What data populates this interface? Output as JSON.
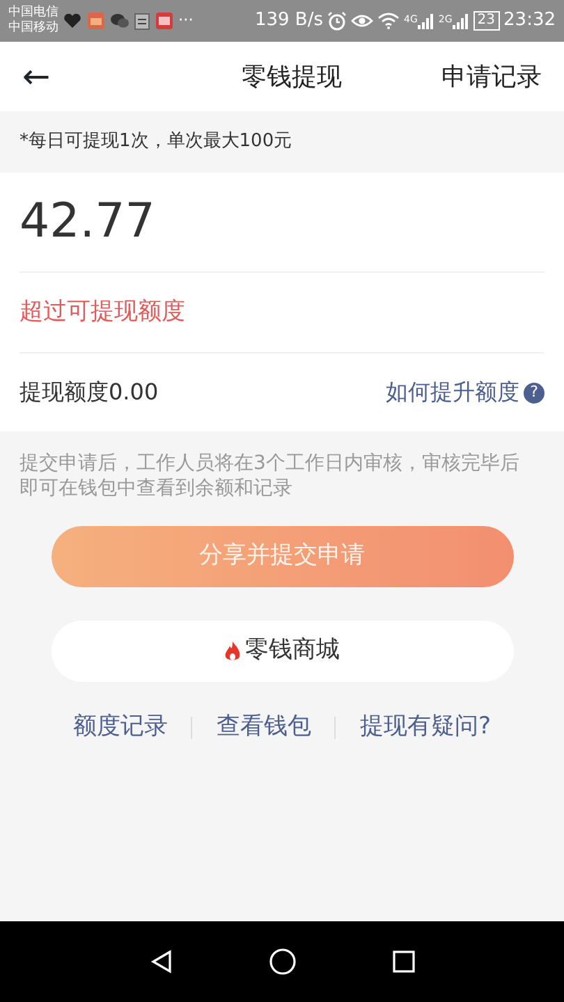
{
  "status_bar": {
    "carriers": [
      "中国电信",
      "中国移动"
    ],
    "more": "···",
    "speed": "139 B/s",
    "networks": [
      "4G",
      "2G"
    ],
    "battery": "23",
    "time": "23:32"
  },
  "header": {
    "back": "←",
    "title": "零钱提现",
    "action": "申请记录"
  },
  "notice": "*每日可提现1次，单次最大100元",
  "amount": "42.77",
  "error": "超过可提现额度",
  "limit": {
    "label": "提现额度0.00",
    "link": "如何提升额度",
    "help": "?"
  },
  "info": "提交申请后，工作人员将在3个工作日内审核，审核完毕后即可在钱包中查看到余额和记录",
  "submit": {
    "label": "分享并提交申请",
    "disabled": true
  },
  "shop": {
    "label": "零钱商城"
  },
  "links": [
    "额度记录",
    "查看钱包",
    "提现有疑问?"
  ]
}
